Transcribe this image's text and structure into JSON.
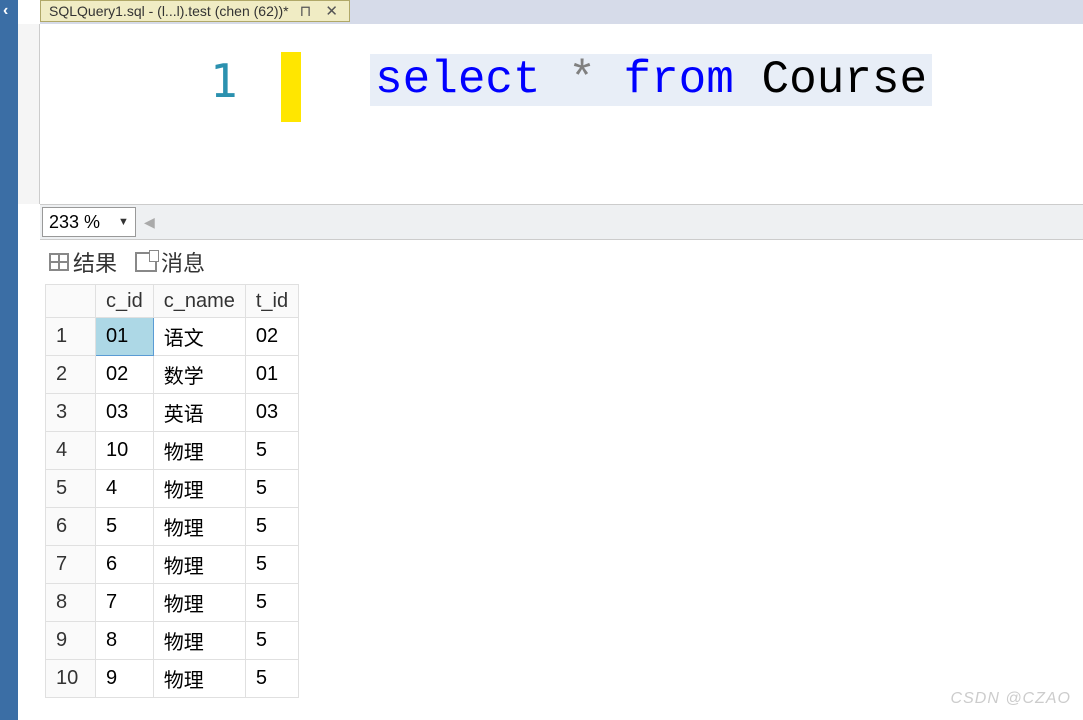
{
  "tab": {
    "title": "SQLQuery1.sql - (l...l).test (chen (62))*"
  },
  "editor": {
    "line_number": "1",
    "sql": {
      "kw1": "select",
      "op": "*",
      "kw2": "from",
      "ident": "Course"
    }
  },
  "zoom": {
    "value": "233 %"
  },
  "result_tabs": {
    "results": "结果",
    "messages": "消息"
  },
  "grid": {
    "columns": [
      "c_id",
      "c_name",
      "t_id"
    ],
    "rows": [
      {
        "n": "1",
        "c_id": "01",
        "c_name": "语文",
        "t_id": "02"
      },
      {
        "n": "2",
        "c_id": "02",
        "c_name": "数学",
        "t_id": "01"
      },
      {
        "n": "3",
        "c_id": "03",
        "c_name": "英语",
        "t_id": "03"
      },
      {
        "n": "4",
        "c_id": "10",
        "c_name": "物理",
        "t_id": "5"
      },
      {
        "n": "5",
        "c_id": "4",
        "c_name": "物理",
        "t_id": "5"
      },
      {
        "n": "6",
        "c_id": "5",
        "c_name": "物理",
        "t_id": "5"
      },
      {
        "n": "7",
        "c_id": "6",
        "c_name": "物理",
        "t_id": "5"
      },
      {
        "n": "8",
        "c_id": "7",
        "c_name": "物理",
        "t_id": "5"
      },
      {
        "n": "9",
        "c_id": "8",
        "c_name": "物理",
        "t_id": "5"
      },
      {
        "n": "10",
        "c_id": "9",
        "c_name": "物理",
        "t_id": "5"
      }
    ],
    "selected": {
      "row": 0,
      "col": "c_id"
    }
  },
  "watermark": "CSDN @CZAO"
}
